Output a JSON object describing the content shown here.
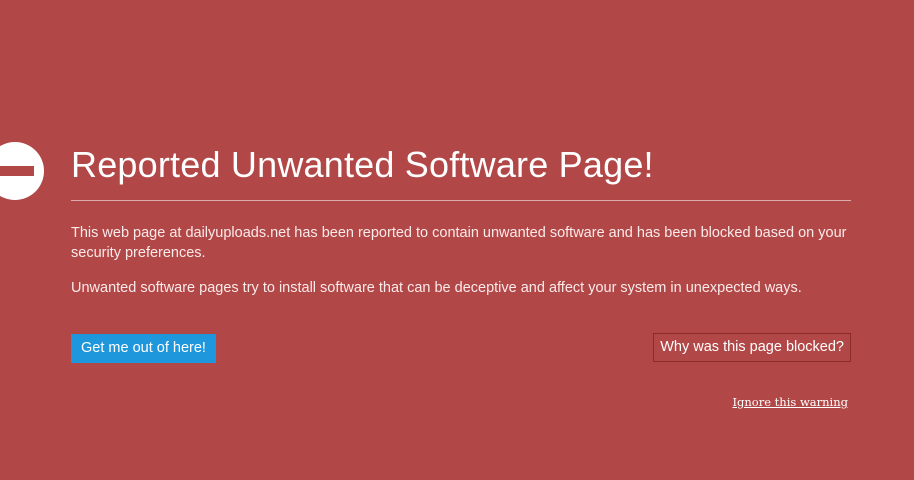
{
  "warning": {
    "title": "Reported Unwanted Software Page!",
    "description": "This web page at dailyuploads.net has been reported to contain unwanted software and has been blocked based on your security preferences.",
    "details": "Unwanted software pages try to install software that can be deceptive and affect your system in unexpected ways.",
    "icon": "block-icon"
  },
  "actions": {
    "get_out_label": "Get me out of here!",
    "why_blocked_label": "Why was this page blocked?",
    "ignore_label": "Ignore this warning"
  },
  "colors": {
    "background": "#b24747",
    "primary_button": "#1f97dd",
    "text": "#ffffff"
  }
}
